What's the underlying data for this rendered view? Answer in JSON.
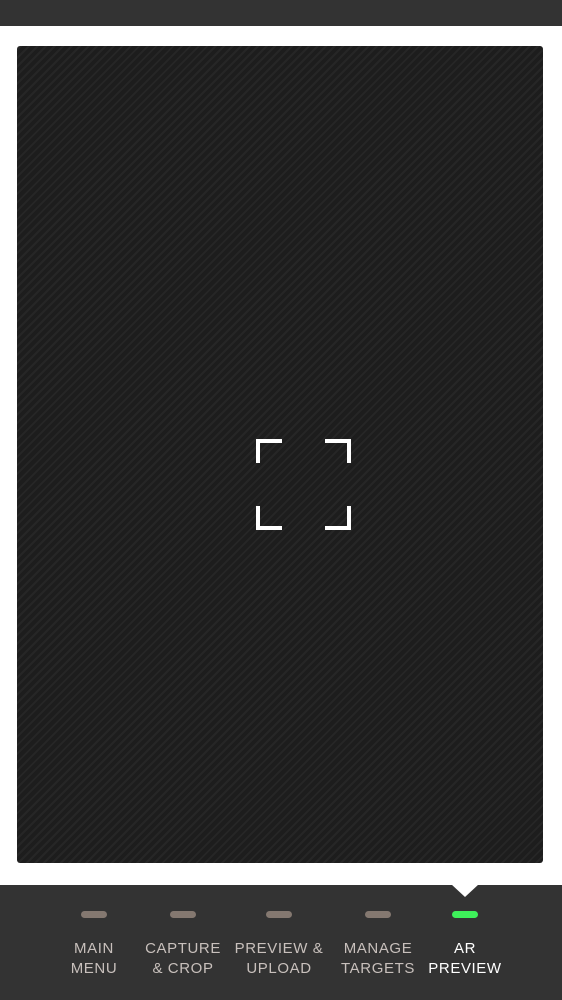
{
  "nav": {
    "items": [
      {
        "line1": "MAIN",
        "line2": "MENU",
        "active": false
      },
      {
        "line1": "CAPTURE",
        "line2": "& CROP",
        "active": false
      },
      {
        "line1": "PREVIEW &",
        "line2": "UPLOAD",
        "active": false
      },
      {
        "line1": "MANAGE",
        "line2": "TARGETS",
        "active": false
      },
      {
        "line1": "AR",
        "line2": "PREVIEW",
        "active": true
      }
    ]
  },
  "colors": {
    "nav_background": "#333333",
    "indicator_inactive": "#847870",
    "indicator_active": "#3ef05a",
    "label_inactive": "#c8c0bc",
    "label_active": "#ffffff",
    "camera_background": "#1c1c1c"
  },
  "icons": {
    "reticle": "scan-frame-icon"
  }
}
